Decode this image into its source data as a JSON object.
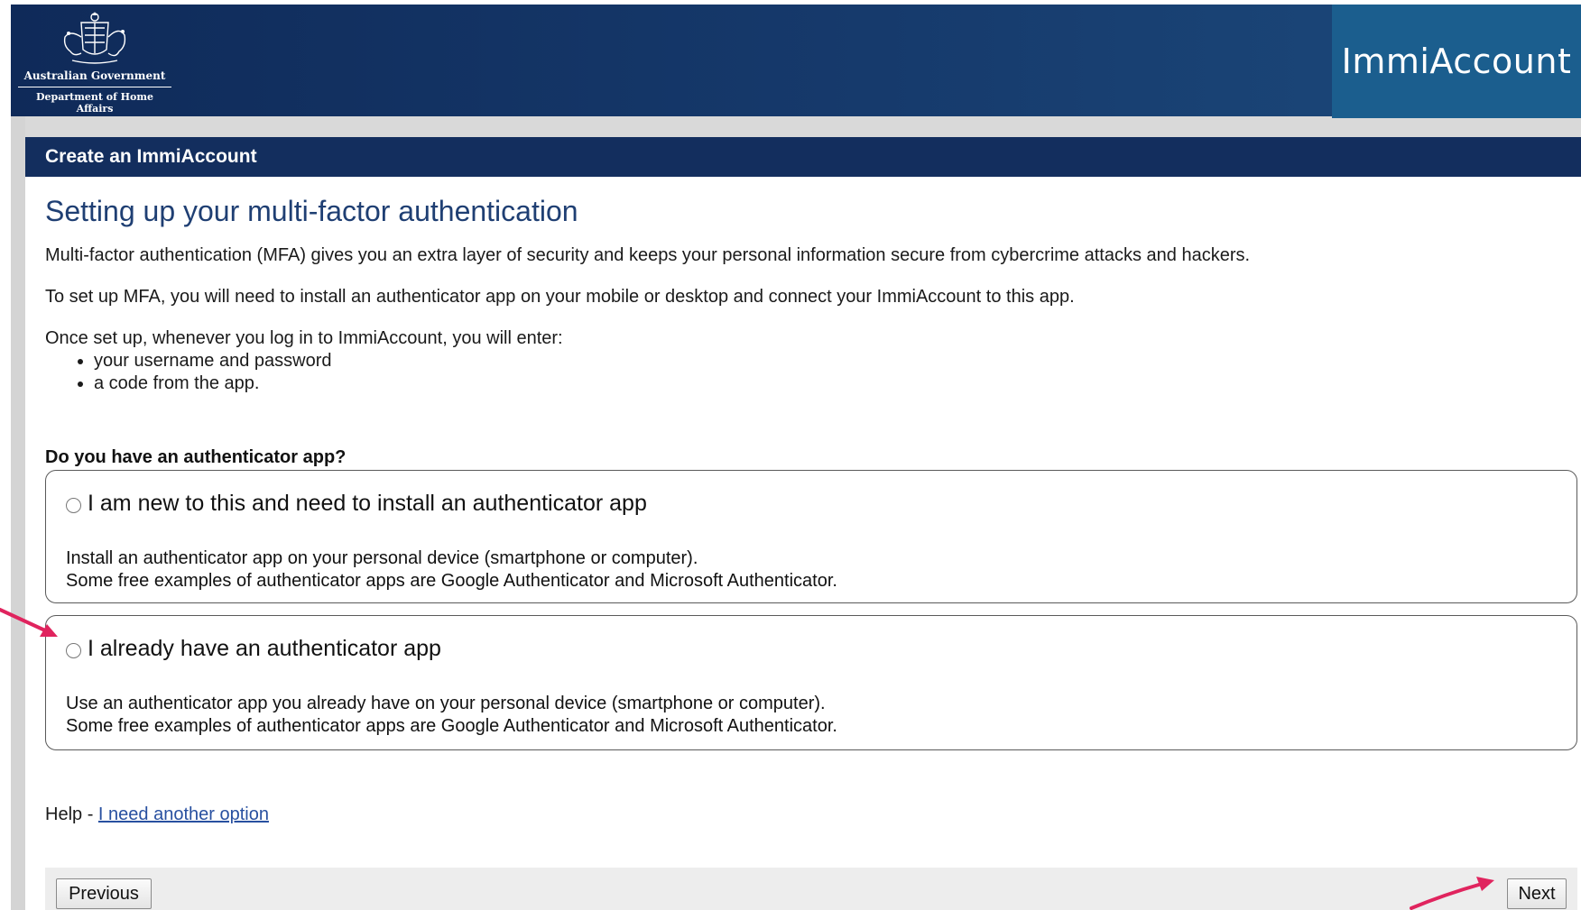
{
  "header": {
    "gov_line1": "Australian Government",
    "gov_line2": "Department of Home Affairs",
    "brand": "ImmiAccount"
  },
  "section": {
    "title": "Create an ImmiAccount"
  },
  "page": {
    "title": "Setting up your multi-factor authentication",
    "intro": "Multi-factor authentication (MFA) gives you an extra layer of security and keeps your personal information secure from cybercrime attacks and hackers.",
    "setup": "To set up MFA, you will need to install an authenticator app on your mobile or desktop and connect your ImmiAccount to this app.",
    "once": "Once set up, whenever you log in to ImmiAccount, you will enter:",
    "bullets": [
      "your username and password",
      "a code from the app."
    ]
  },
  "question": "Do you have an authenticator app?",
  "options": [
    {
      "label": "I am new to this and need to install an authenticator app",
      "desc1": "Install an authenticator app on your personal device (smartphone or computer).",
      "desc2": "Some free examples of authenticator apps are Google Authenticator and Microsoft Authenticator.",
      "selected": false
    },
    {
      "label": "I already have an authenticator app",
      "desc1": "Use an authenticator app you already have on your personal device (smartphone or computer).",
      "desc2": "Some free examples of authenticator apps are Google Authenticator and Microsoft Authenticator.",
      "selected": false
    }
  ],
  "help": {
    "prefix": "Help - ",
    "link": "I need another option"
  },
  "nav": {
    "previous": "Previous",
    "next": "Next"
  },
  "colors": {
    "header_navy": "#132e5e",
    "brand_blue": "#1b5e8e",
    "title_blue": "#1f3f73",
    "annotation_red": "#e0245e"
  }
}
